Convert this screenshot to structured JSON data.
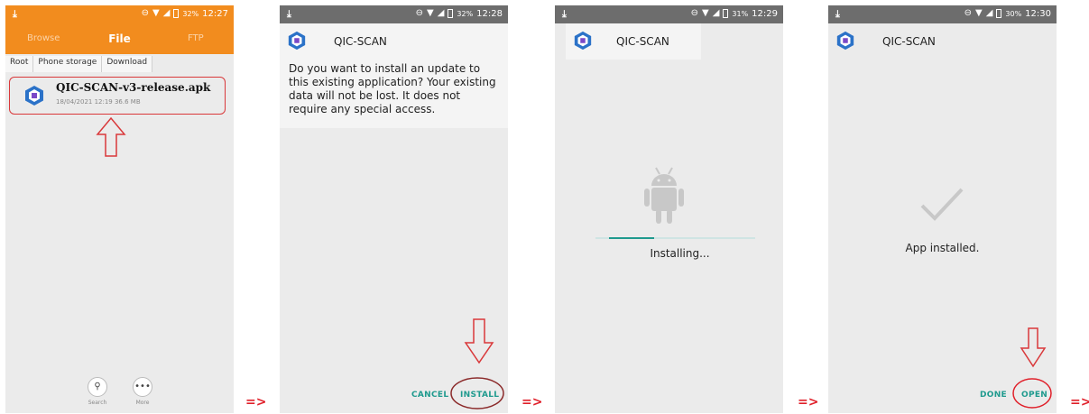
{
  "file_manager": {
    "status_bar": {
      "battery": "32%",
      "time": "12:27"
    },
    "tabs": [
      "Browse",
      "File",
      "FTP"
    ],
    "breadcrumb": [
      "Root",
      "Phone storage",
      "Download"
    ],
    "file": {
      "name": "QIC-SCAN-v3-release.apk",
      "meta": "18/04/2021 12:19  36.6 MB"
    },
    "bottom_bar": {
      "search_label": "Search",
      "more_label": "More"
    }
  },
  "install_prompt": {
    "status_bar": {
      "battery": "32%",
      "time": "12:28"
    },
    "app_name": "QIC-SCAN",
    "message": "Do you want to install an update to this existing application? Your existing data will not be lost. It does not require any special access.",
    "cancel_label": "CANCEL",
    "install_label": "INSTALL"
  },
  "installing": {
    "status_bar": {
      "battery": "31%",
      "time": "12:29"
    },
    "app_name": "QIC-SCAN",
    "status": "Installing..."
  },
  "installed": {
    "status_bar": {
      "battery": "30%",
      "time": "12:30"
    },
    "app_name": "QIC-SCAN",
    "status": "App installed.",
    "done_label": "DONE",
    "open_label": "OPEN"
  },
  "separator": "=>",
  "colors": {
    "orange": "#f28c1e",
    "teal": "#1f9a8e",
    "annotation_red": "#d9383a"
  }
}
